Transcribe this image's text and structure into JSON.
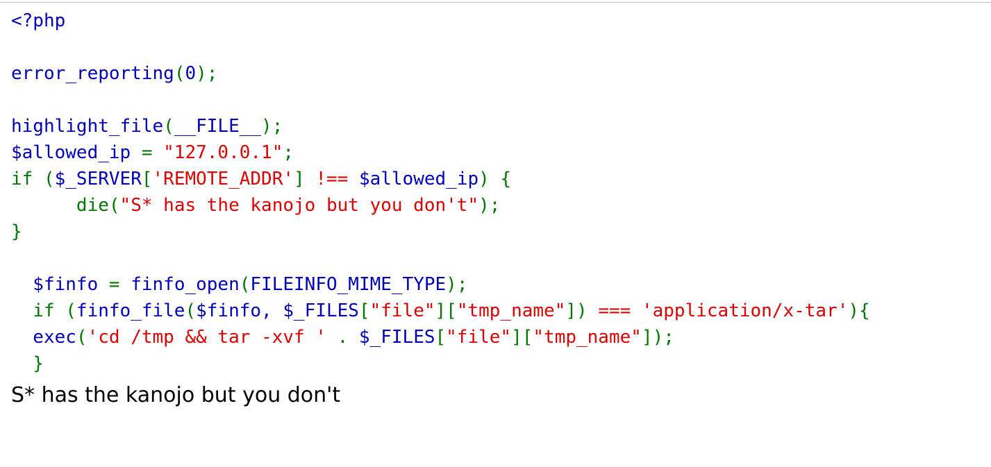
{
  "page": {
    "background_color": "#ffffff",
    "top_rule_color": "#c8c8c8"
  },
  "palette": {
    "default": "#0000bb",
    "keyword": "#007700",
    "string": "#dd0000",
    "comment": "#ff8000",
    "plain_text": "#000000"
  },
  "source": {
    "language": "php",
    "lines": [
      {
        "id": "line-1",
        "segments": [
          {
            "cls": "tk-default",
            "text": "<?php"
          }
        ]
      },
      {
        "id": "line-2",
        "segments": []
      },
      {
        "id": "line-3",
        "segments": [
          {
            "cls": "tk-default",
            "text": "error_reporting"
          },
          {
            "cls": "tk-keyword",
            "text": "("
          },
          {
            "cls": "tk-default",
            "text": "0"
          },
          {
            "cls": "tk-keyword",
            "text": ");"
          }
        ]
      },
      {
        "id": "line-4",
        "segments": []
      },
      {
        "id": "line-5",
        "segments": [
          {
            "cls": "tk-default",
            "text": "highlight_file"
          },
          {
            "cls": "tk-keyword",
            "text": "("
          },
          {
            "cls": "tk-default",
            "text": "__FILE__"
          },
          {
            "cls": "tk-keyword",
            "text": ");"
          }
        ]
      },
      {
        "id": "line-6",
        "segments": [
          {
            "cls": "tk-default",
            "text": "$allowed_ip "
          },
          {
            "cls": "tk-keyword",
            "text": "= "
          },
          {
            "cls": "tk-string",
            "text": "\"127.0.0.1\""
          },
          {
            "cls": "tk-keyword",
            "text": ";"
          }
        ]
      },
      {
        "id": "line-7",
        "segments": [
          {
            "cls": "tk-keyword",
            "text": "if ("
          },
          {
            "cls": "tk-default",
            "text": "$_SERVER"
          },
          {
            "cls": "tk-keyword",
            "text": "["
          },
          {
            "cls": "tk-string",
            "text": "'REMOTE_ADDR'"
          },
          {
            "cls": "tk-keyword",
            "text": "] "
          },
          {
            "cls": "tk-string",
            "text": "!== "
          },
          {
            "cls": "tk-default",
            "text": "$allowed_ip"
          },
          {
            "cls": "tk-keyword",
            "text": ") {"
          }
        ]
      },
      {
        "id": "line-8",
        "segments": [
          {
            "cls": "tk-keyword",
            "text": "      die"
          },
          {
            "cls": "tk-keyword",
            "text": "("
          },
          {
            "cls": "tk-string",
            "text": "\"S* has the kanojo but you don't\""
          },
          {
            "cls": "tk-keyword",
            "text": ");"
          }
        ]
      },
      {
        "id": "line-9",
        "segments": [
          {
            "cls": "tk-keyword",
            "text": "}"
          }
        ]
      },
      {
        "id": "line-10",
        "segments": []
      },
      {
        "id": "line-11",
        "segments": [
          {
            "cls": "tk-default",
            "text": "  $finfo "
          },
          {
            "cls": "tk-keyword",
            "text": "= "
          },
          {
            "cls": "tk-default",
            "text": "finfo_open"
          },
          {
            "cls": "tk-keyword",
            "text": "("
          },
          {
            "cls": "tk-default",
            "text": "FILEINFO_MIME_TYPE"
          },
          {
            "cls": "tk-keyword",
            "text": ");"
          }
        ]
      },
      {
        "id": "line-12",
        "segments": [
          {
            "cls": "tk-keyword",
            "text": "  if ("
          },
          {
            "cls": "tk-default",
            "text": "finfo_file"
          },
          {
            "cls": "tk-keyword",
            "text": "("
          },
          {
            "cls": "tk-default",
            "text": "$finfo, $_FILES"
          },
          {
            "cls": "tk-keyword",
            "text": "["
          },
          {
            "cls": "tk-string",
            "text": "\"file\""
          },
          {
            "cls": "tk-keyword",
            "text": "]["
          },
          {
            "cls": "tk-string",
            "text": "\"tmp_name\""
          },
          {
            "cls": "tk-keyword",
            "text": "]) "
          },
          {
            "cls": "tk-string",
            "text": "=== "
          },
          {
            "cls": "tk-string",
            "text": "'application/x-tar'"
          },
          {
            "cls": "tk-keyword",
            "text": "){"
          }
        ]
      },
      {
        "id": "line-13",
        "segments": [
          {
            "cls": "tk-default",
            "text": "  exec"
          },
          {
            "cls": "tk-keyword",
            "text": "("
          },
          {
            "cls": "tk-string",
            "text": "'cd /tmp && tar -xvf '"
          },
          {
            "cls": "tk-keyword",
            "text": " . "
          },
          {
            "cls": "tk-default",
            "text": "$_FILES"
          },
          {
            "cls": "tk-keyword",
            "text": "["
          },
          {
            "cls": "tk-string",
            "text": "\"file\""
          },
          {
            "cls": "tk-keyword",
            "text": "]["
          },
          {
            "cls": "tk-string",
            "text": "\"tmp_name\""
          },
          {
            "cls": "tk-keyword",
            "text": "]);"
          }
        ]
      },
      {
        "id": "line-14",
        "segments": [
          {
            "cls": "tk-keyword",
            "text": "  }"
          }
        ]
      }
    ]
  },
  "output": {
    "die_message": "S* has the kanojo but you don't"
  }
}
